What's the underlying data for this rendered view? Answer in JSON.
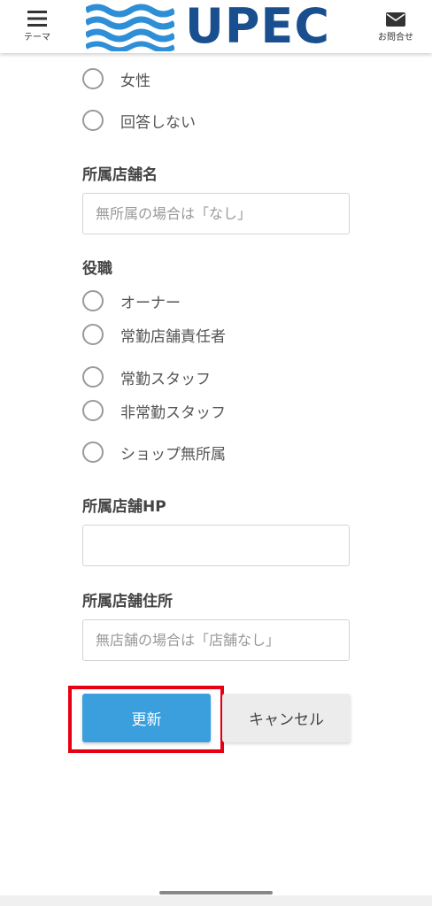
{
  "header": {
    "menu_label": "テーマ",
    "logo_text": "UPEC",
    "contact_label": "お問合せ",
    "brand_color": "#1a4f8f",
    "wave_color": "#2e8fd6"
  },
  "gender": {
    "options": [
      "女性",
      "回答しない"
    ]
  },
  "store_name": {
    "label": "所属店舗名",
    "placeholder": "無所属の場合は「なし」",
    "value": ""
  },
  "position": {
    "label": "役職",
    "options": [
      "オーナー",
      "常勤店舗責任者",
      "常勤スタッフ",
      "非常勤スタッフ",
      "ショップ無所属"
    ]
  },
  "store_hp": {
    "label": "所属店舗HP",
    "placeholder": "",
    "value": ""
  },
  "store_address": {
    "label": "所属店舗住所",
    "placeholder": "無店舗の場合は「店舗なし」",
    "value": ""
  },
  "actions": {
    "update_label": "更新",
    "cancel_label": "キャンセル",
    "update_color": "#3a9fdc",
    "highlight_color": "#e60012"
  }
}
